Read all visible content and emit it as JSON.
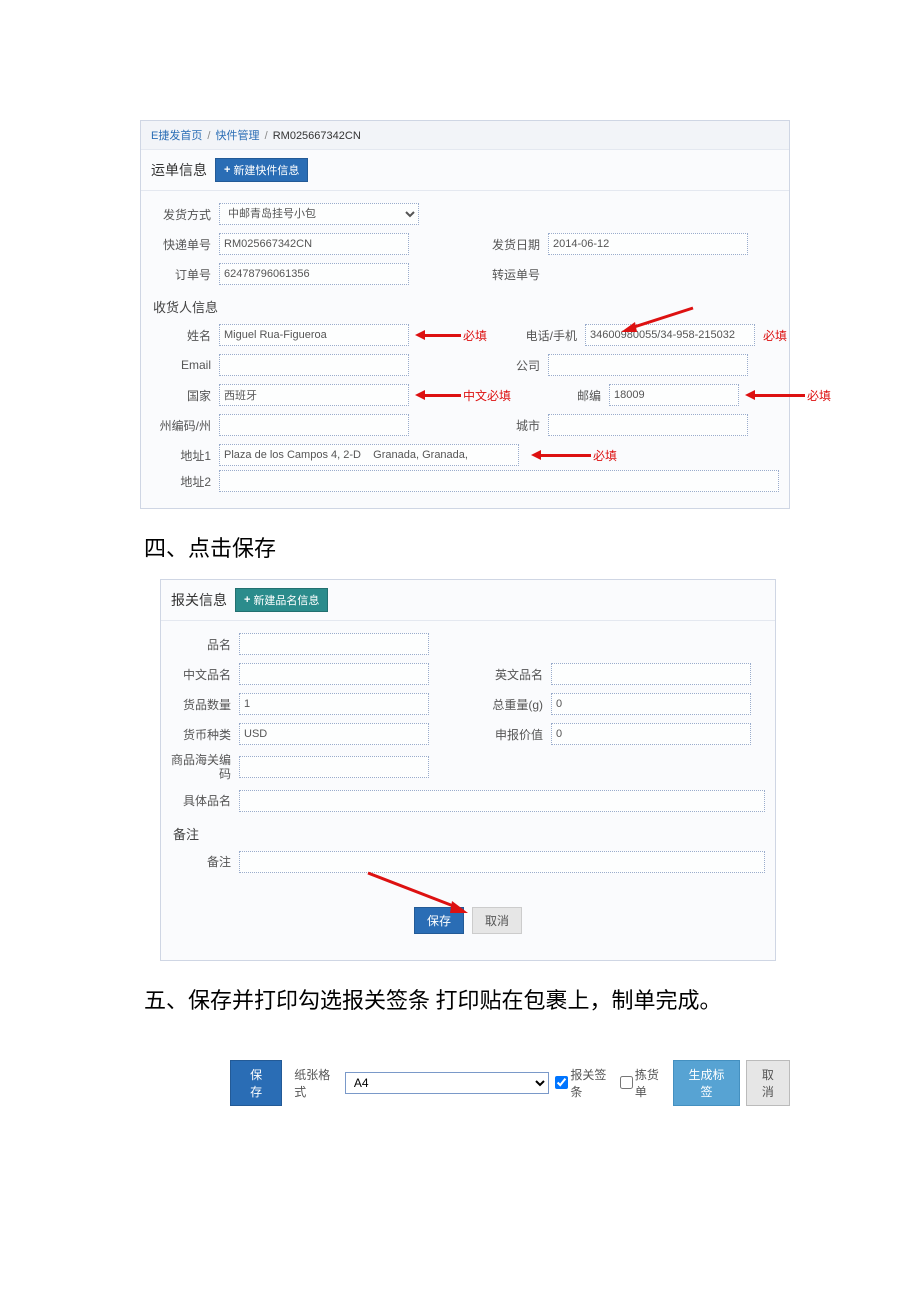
{
  "breadcrumb": {
    "home": "E捷发首页",
    "mgmt": "快件管理",
    "current": "RM025667342CN"
  },
  "shipping": {
    "section_title": "运单信息",
    "new_btn": "新建快件信息",
    "method_label": "发货方式",
    "method_value": "中邮青岛挂号小包",
    "trackno_label": "快递单号",
    "trackno_value": "RM025667342CN",
    "date_label": "发货日期",
    "date_value": "2014-06-12",
    "orderno_label": "订单号",
    "orderno_value": "62478796061356",
    "transfer_label": "转运单号",
    "transfer_value": ""
  },
  "recipient": {
    "title": "收货人信息",
    "name_label": "姓名",
    "name_value": "Miguel Rua-Figueroa",
    "name_note": "必填",
    "email_label": "Email",
    "email_value": "",
    "country_label": "国家",
    "country_value": "西班牙",
    "country_note": "中文必填",
    "statecode_label": "州编码/州",
    "statecode_value": "",
    "addr1_label": "地址1",
    "addr1_value": "Plaza de los Campos 4, 2-D    Granada, Granada,",
    "addr1_note": "必填",
    "addr2_label": "地址2",
    "addr2_value": "",
    "phone_label": "电话/手机",
    "phone_value": "34600980055/34-958-215032",
    "phone_note": "必填",
    "company_label": "公司",
    "company_value": "",
    "zip_label": "邮编",
    "zip_value": "18009",
    "zip_note": "必填",
    "city_label": "城市",
    "city_value": ""
  },
  "h4": "四、点击保存",
  "customs": {
    "section_title": "报关信息",
    "new_btn": "新建品名信息",
    "pname_label": "品名",
    "pname_value": "",
    "cname_label": "中文品名",
    "cname_value": "",
    "ename_label": "英文品名",
    "ename_value": "",
    "qty_label": "货品数量",
    "qty_value": "1",
    "weight_label": "总重量(g)",
    "weight_value": "0",
    "currency_label": "货币种类",
    "currency_value": "USD",
    "decval_label": "申报价值",
    "decval_value": "0",
    "hs_label": "商品海关编码",
    "hs_value": "",
    "detail_label": "具体品名",
    "detail_value": "",
    "remark_title": "备注",
    "remark_label": "备注",
    "remark_value": "",
    "save_btn": "保存",
    "cancel_btn": "取消"
  },
  "h5": "五、保存并打印勾选报关签条 打印贴在包裹上，制单完成。",
  "print": {
    "save": "保存",
    "paper_label": "纸张格式",
    "paper_value": "A4",
    "customs_cb": "报关签条",
    "pick_cb": "拣货单",
    "gen": "生成标签",
    "cancel": "取消"
  }
}
